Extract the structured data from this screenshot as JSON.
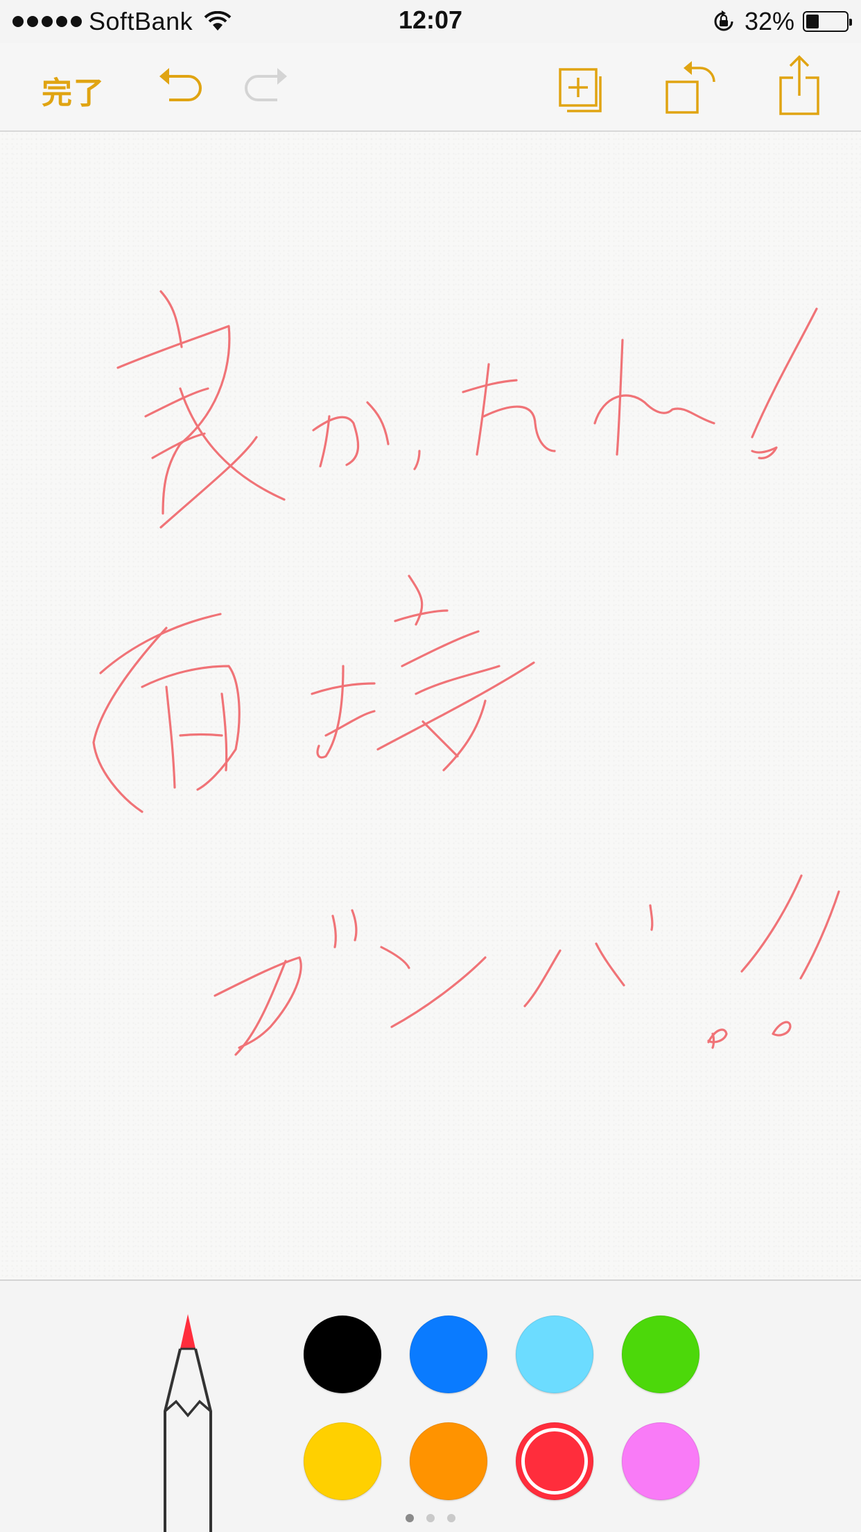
{
  "status_bar": {
    "carrier": "SoftBank",
    "time": "12:07",
    "battery_percent_text": "32%",
    "battery_level": 0.32
  },
  "toolbar": {
    "done_label": "完了",
    "accent_color": "#e0a412",
    "disabled_color": "#d4d4d4"
  },
  "palette": {
    "colors": [
      {
        "name": "black",
        "hex": "#000000"
      },
      {
        "name": "blue",
        "hex": "#0a7bff"
      },
      {
        "name": "light-blue",
        "hex": "#6cdcff"
      },
      {
        "name": "green",
        "hex": "#4cd80a"
      },
      {
        "name": "yellow",
        "hex": "#ffd000"
      },
      {
        "name": "orange",
        "hex": "#ff9300"
      },
      {
        "name": "red",
        "hex": "#ff2d3c"
      },
      {
        "name": "pink",
        "hex": "#f97bf7"
      }
    ],
    "selected": "red",
    "ink_color": "#f07377",
    "page_count": 3,
    "active_page": 0
  }
}
